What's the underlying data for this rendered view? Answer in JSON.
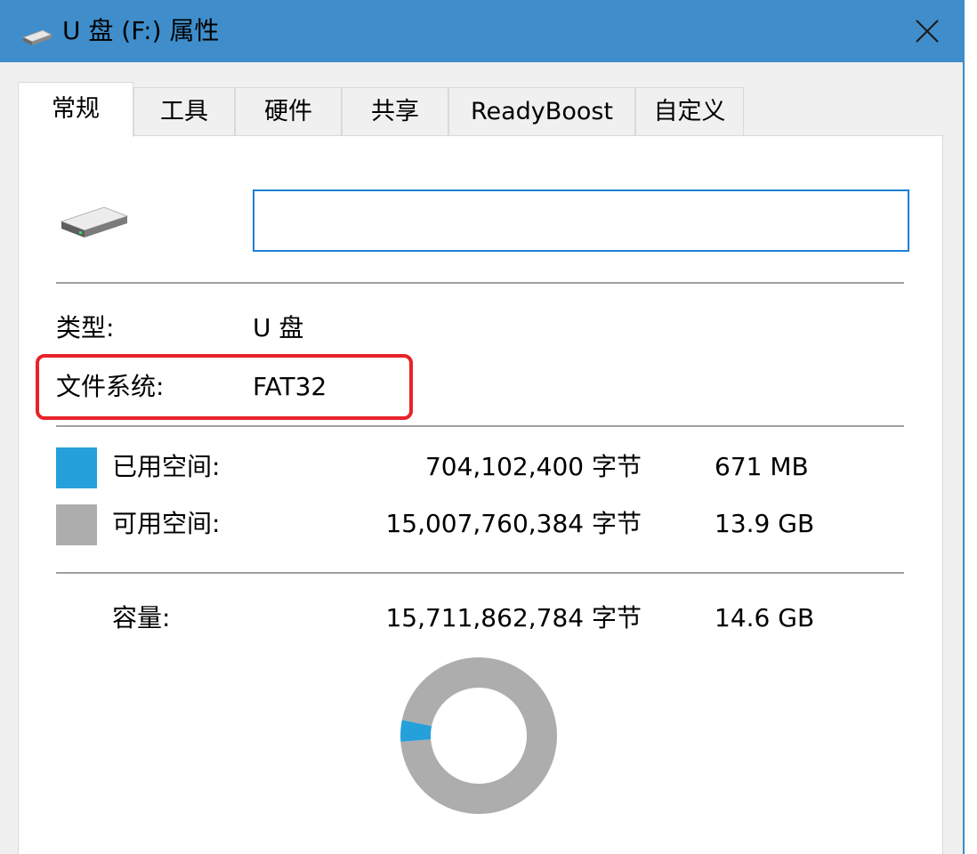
{
  "window": {
    "title": "U 盘 (F:) 属性",
    "title_icon": "usb-drive-icon",
    "close_glyph": "✕"
  },
  "tabs": [
    {
      "label": "常规",
      "active": true
    },
    {
      "label": "工具",
      "active": false
    },
    {
      "label": "硬件",
      "active": false
    },
    {
      "label": "共享",
      "active": false
    },
    {
      "label": "ReadyBoost",
      "active": false
    },
    {
      "label": "自定义",
      "active": false
    }
  ],
  "general": {
    "drive_icon": "usb-drive-icon",
    "volume_name_value": "",
    "type_label": "类型:",
    "type_value": "U 盘",
    "fs_label": "文件系统:",
    "fs_value": "FAT32",
    "used_label": "已用空间:",
    "used_bytes": "704,102,400 字节",
    "used_human": "671 MB",
    "free_label": "可用空间:",
    "free_bytes": "15,007,760,384 字节",
    "free_human": "13.9 GB",
    "capacity_label": "容量:",
    "capacity_bytes": "15,711,862,784 字节",
    "capacity_human": "14.6 GB"
  },
  "colors": {
    "titlebar": "#3f8ecb",
    "used": "#26a0da",
    "free": "#adadad",
    "highlight": "#e8222a",
    "input_border": "#1f7fd6"
  },
  "chart_data": {
    "type": "pie",
    "categories": [
      "已用空间",
      "可用空间"
    ],
    "values": [
      704102400,
      15007760384
    ]
  }
}
